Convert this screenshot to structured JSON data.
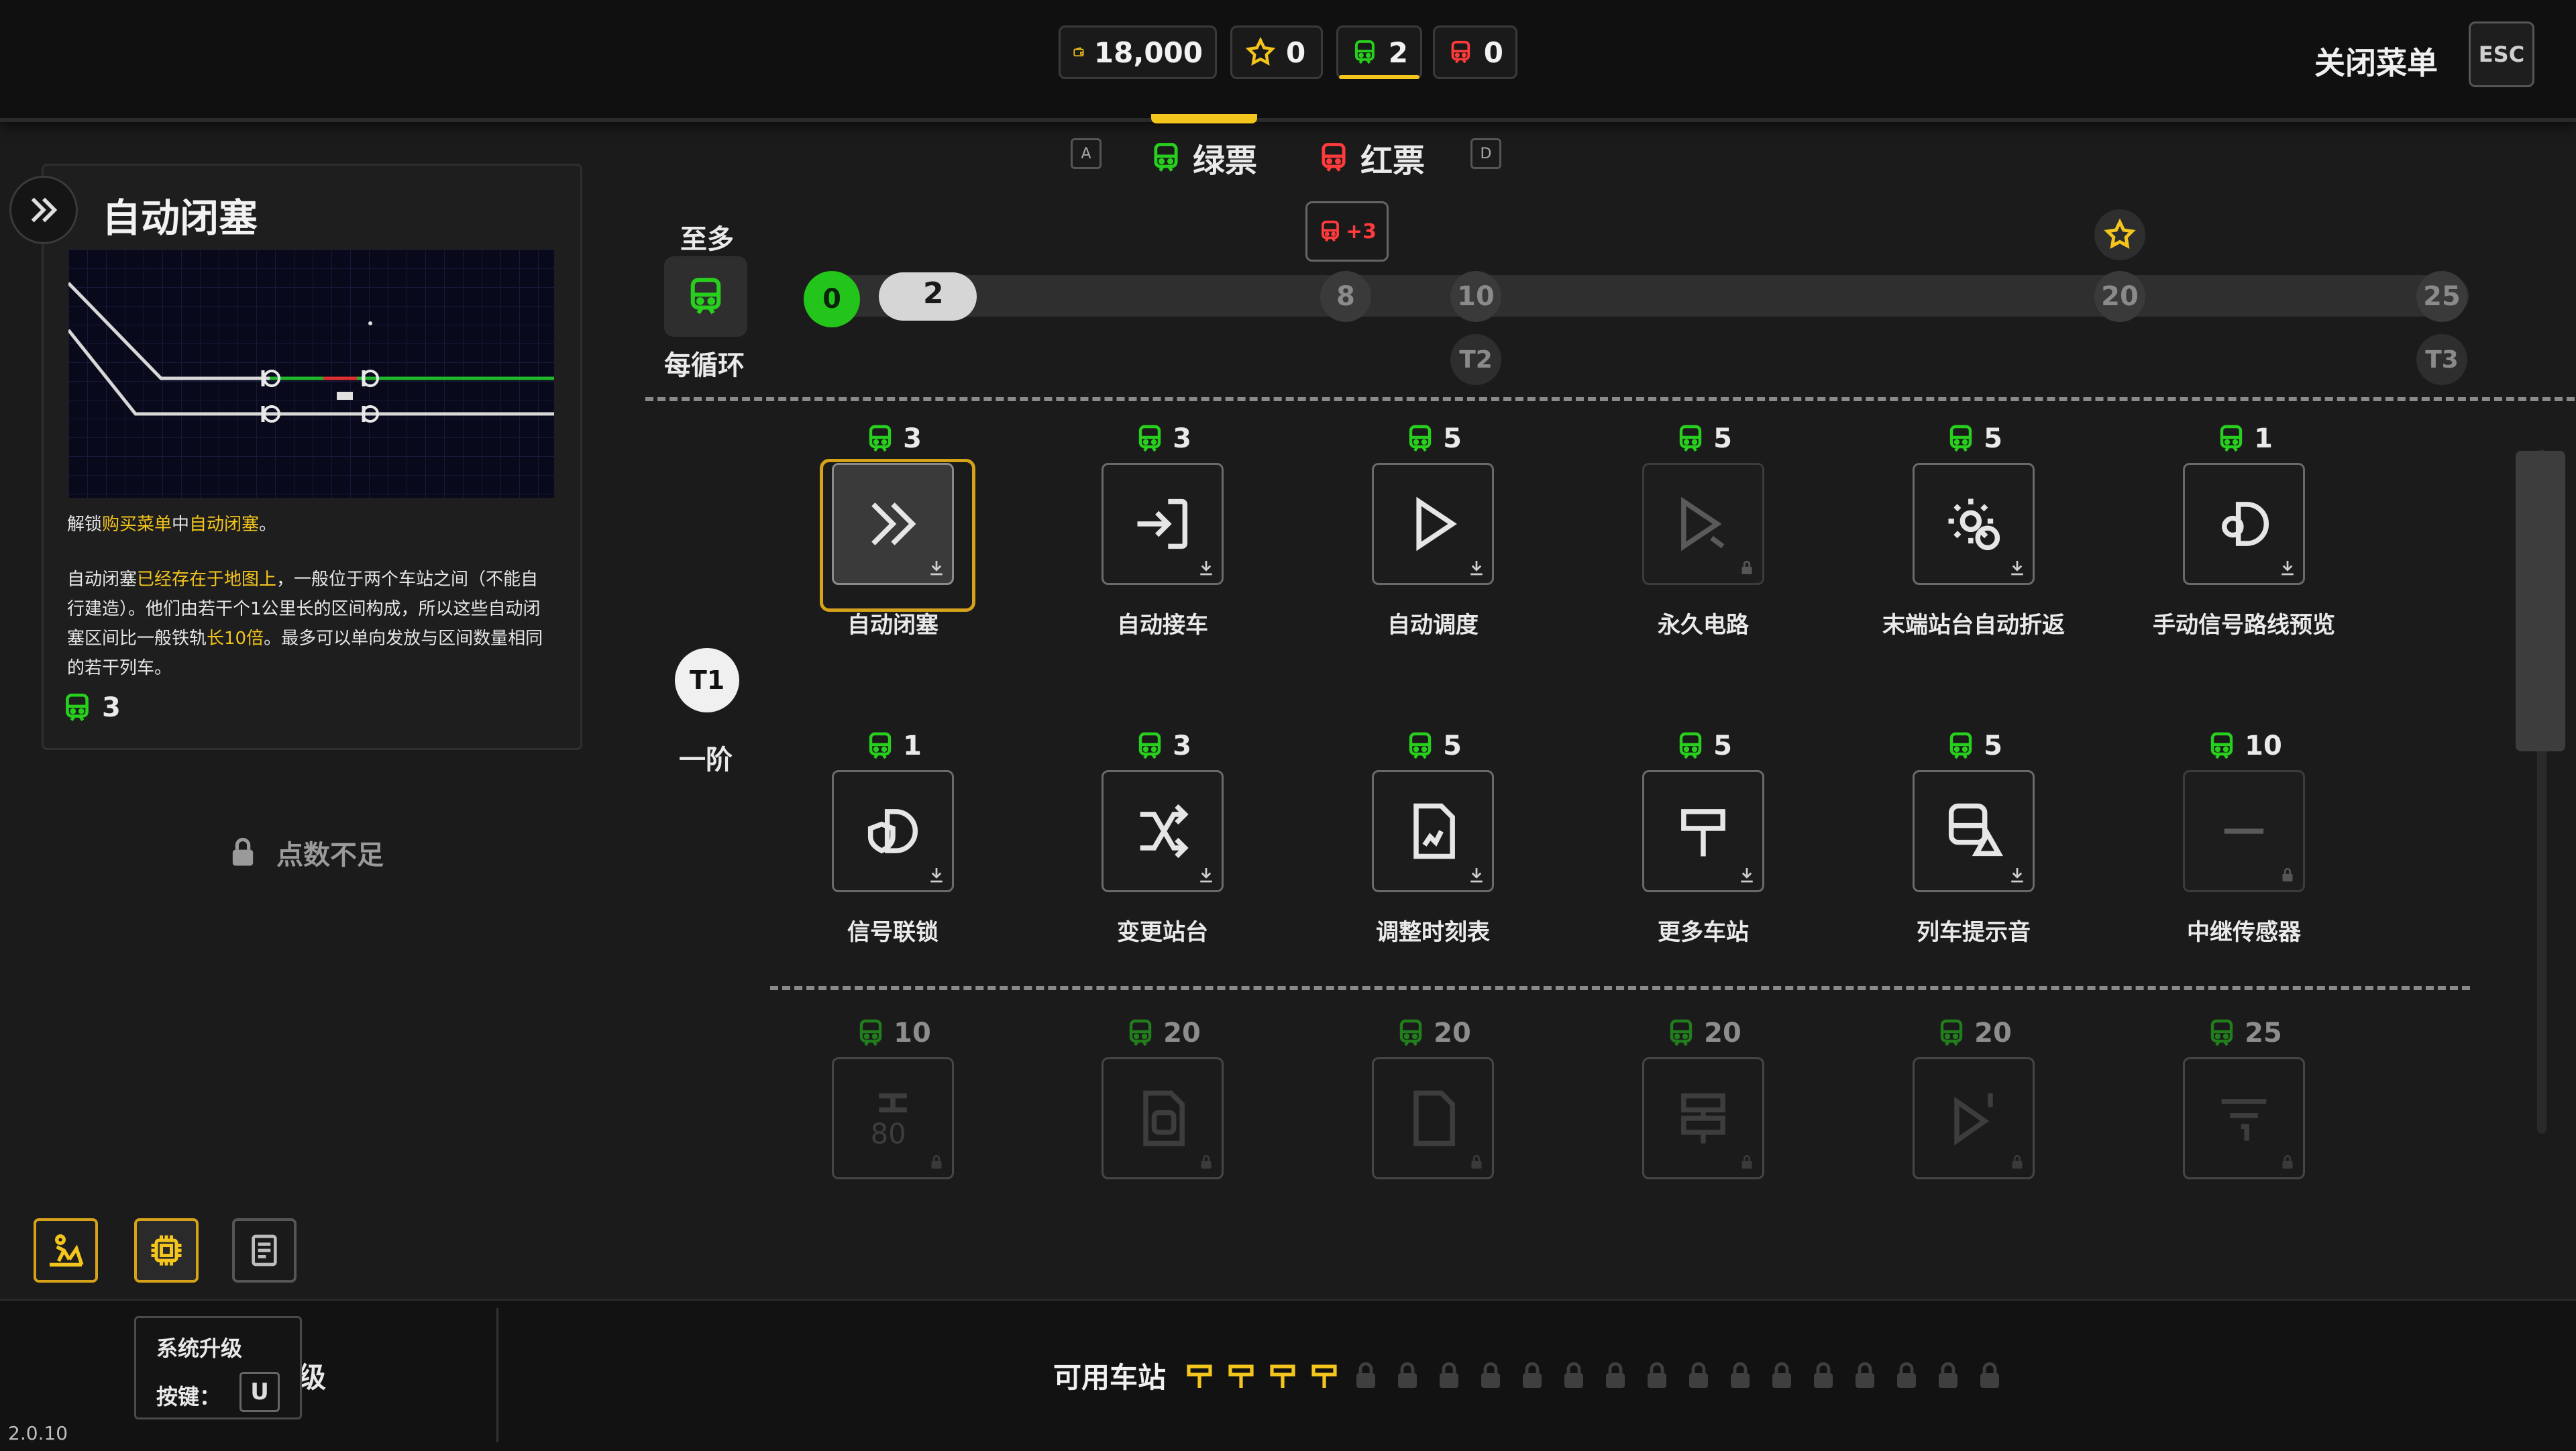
{
  "resources": [
    {
      "id": "money",
      "value": "18,000",
      "icon": "wallet-icon",
      "color": "#f4c51c"
    },
    {
      "id": "stars",
      "value": "0",
      "icon": "star-icon",
      "color": "#f4c51c"
    },
    {
      "id": "green_tickets",
      "value": "2",
      "icon": "train-icon",
      "color": "#28d01e"
    },
    {
      "id": "red_tickets",
      "value": "0",
      "icon": "train-icon",
      "color": "#ff3b3b"
    }
  ],
  "close_menu": {
    "label": "关闭菜单",
    "key": "ESC"
  },
  "tabs": {
    "prev_key": "A",
    "next_key": "D",
    "green_label": "绿票",
    "red_label": "红票"
  },
  "detail": {
    "title": "自动闭塞",
    "line1": [
      {
        "t": "解锁",
        "h": false
      },
      {
        "t": "购买菜单",
        "h": true
      },
      {
        "t": "中",
        "h": false
      },
      {
        "t": "自动闭塞",
        "h": true
      },
      {
        "t": "。",
        "h": false
      }
    ],
    "line2": [
      {
        "t": "自动闭塞",
        "h": false
      },
      {
        "t": "已经存在于地图上",
        "h": true
      },
      {
        "t": "，一般位于两个车站之间（不能自行建造）。他们由若干个1公里长的区间构成，所以这些自动闭塞区间比一般铁轨",
        "h": false
      },
      {
        "t": "长10倍",
        "h": true
      },
      {
        "t": "。最多可以单向发放与区间数量相同的若干列车。",
        "h": false
      }
    ],
    "cost": "3",
    "insufficient": "点数不足"
  },
  "progress": {
    "top_label": "至多",
    "bottom_label": "每循环",
    "current": "0",
    "max": "2",
    "bonus": "+3",
    "milestones": [
      "8",
      "10",
      "20",
      "25"
    ],
    "tier_labels": {
      "t2": "T2",
      "t3": "T3"
    }
  },
  "tier": {
    "badge": "T1",
    "label": "一阶"
  },
  "cards": [
    {
      "name": "自动闭塞",
      "cost": "3",
      "icon": "double-chevron-icon",
      "state": "selected"
    },
    {
      "name": "自动接车",
      "cost": "3",
      "icon": "enter-icon",
      "state": "available"
    },
    {
      "name": "自动调度",
      "cost": "5",
      "icon": "play-icon",
      "state": "available"
    },
    {
      "name": "永久电路",
      "cost": "5",
      "icon": "play-link-icon",
      "state": "locked"
    },
    {
      "name": "末端站台自动折返",
      "cost": "5",
      "icon": "gear-cycle-icon",
      "state": "available"
    },
    {
      "name": "手动信号路线预览",
      "cost": "1",
      "icon": "signal-eye-icon",
      "state": "available"
    },
    {
      "name": "信号联锁",
      "cost": "1",
      "icon": "signal-shield-icon",
      "state": "available"
    },
    {
      "name": "变更站台",
      "cost": "3",
      "icon": "shuffle-icon",
      "state": "available"
    },
    {
      "name": "调整时刻表",
      "cost": "5",
      "icon": "timetable-icon",
      "state": "available"
    },
    {
      "name": "更多车站",
      "cost": "5",
      "icon": "station-sign-icon",
      "state": "available"
    },
    {
      "name": "列车提示音",
      "cost": "5",
      "icon": "train-warning-icon",
      "state": "available"
    },
    {
      "name": "中继传感器",
      "cost": "10",
      "icon": "dash-icon",
      "state": "locked"
    },
    {
      "name": "",
      "cost": "10",
      "icon": "speed-80-icon",
      "state": "dim"
    },
    {
      "name": "",
      "cost": "20",
      "icon": "train-doc-icon",
      "state": "dim"
    },
    {
      "name": "",
      "cost": "20",
      "icon": "doc-icon",
      "state": "dim"
    },
    {
      "name": "",
      "cost": "20",
      "icon": "double-sign-icon",
      "state": "dim"
    },
    {
      "name": "",
      "cost": "20",
      "icon": "play-one-icon",
      "state": "dim"
    },
    {
      "name": "",
      "cost": "25",
      "icon": "filter-one-icon",
      "state": "dim"
    }
  ],
  "bottom": {
    "stations_label": "可用车站",
    "stations_unlocked": 4,
    "stations_locked": 16,
    "tooltip_title": "系统升级",
    "tooltip_key_label": "按键：",
    "tooltip_key": "U",
    "hidden_label_tail": "级",
    "version": "2.0.10"
  },
  "colors": {
    "green": "#28d01e",
    "red": "#ff3b3b",
    "yellow": "#f4c51c"
  }
}
